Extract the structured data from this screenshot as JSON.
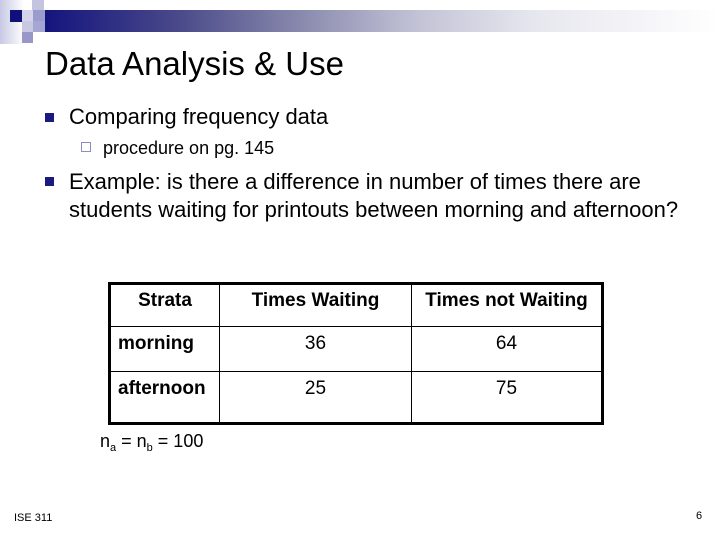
{
  "slide": {
    "title": "Data Analysis & Use",
    "bullets": [
      {
        "text": "Comparing frequency data",
        "sub": [
          "procedure on pg. 145"
        ]
      },
      {
        "text": "Example: is there a difference in number of times there are students waiting for printouts between morning and afternoon?"
      }
    ],
    "table": {
      "headers": [
        "Strata",
        "Times Waiting",
        "Times not Waiting"
      ],
      "rows": [
        [
          "morning",
          "36",
          "64"
        ],
        [
          "afternoon",
          "25",
          "75"
        ]
      ]
    },
    "formula": {
      "n": "n",
      "sub_a": "a",
      "eq1": " = ",
      "sub_b": "b",
      "eq2": " = 100"
    },
    "footer": {
      "course": "ISE 311",
      "page": "6"
    },
    "colors": {
      "accent": "#1a1a80",
      "sub_bullet_border": "#8c8cc0"
    }
  }
}
